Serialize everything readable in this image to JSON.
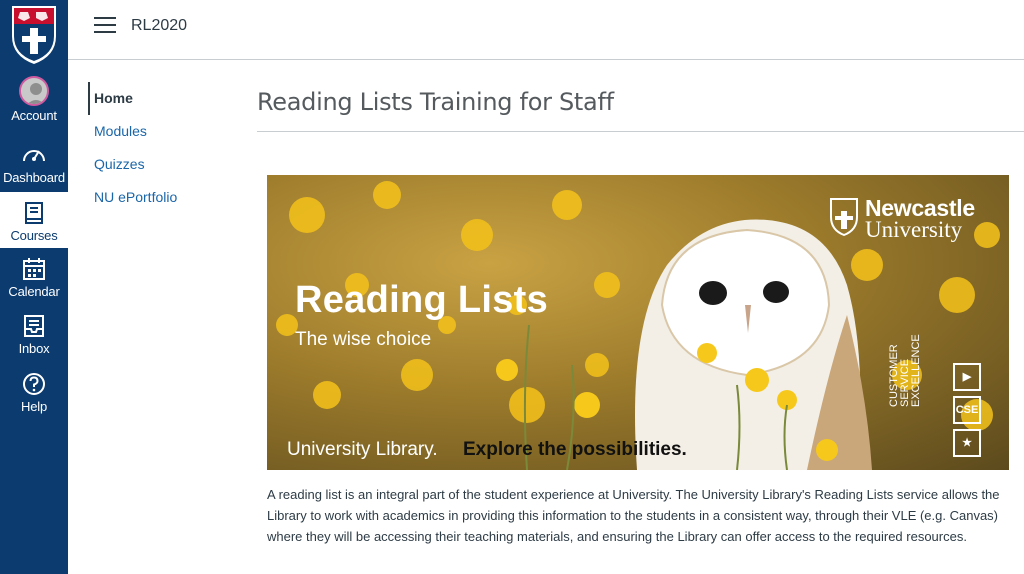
{
  "global_nav": {
    "items": [
      {
        "label": "Account",
        "icon": "avatar"
      },
      {
        "label": "Dashboard",
        "icon": "speedometer-icon"
      },
      {
        "label": "Courses",
        "icon": "book-icon"
      },
      {
        "label": "Calendar",
        "icon": "calendar-icon"
      },
      {
        "label": "Inbox",
        "icon": "inbox-icon"
      },
      {
        "label": "Help",
        "icon": "help-icon"
      }
    ],
    "active": "Courses",
    "brand_color": "#0b3b6f"
  },
  "header": {
    "breadcrumb": "RL2020"
  },
  "course_nav": {
    "items": [
      "Home",
      "Modules",
      "Quizzes",
      "NU ePortfolio"
    ],
    "active": "Home"
  },
  "page": {
    "title": "Reading Lists Training for Staff"
  },
  "banner": {
    "headline": "Reading Lists",
    "subline": "The wise choice",
    "footer_part1": "University Library.",
    "footer_part2": "Explore the possibilities.",
    "logo_line1": "Newcastle",
    "logo_line2": "University",
    "cse_text": [
      "CUSTOMER",
      "SERVICE",
      "EXCELLENCE"
    ],
    "cse_badges": [
      "▶",
      "CSE",
      "★"
    ]
  },
  "body_text": "A reading list is an integral part of the student experience at University. The University Library's Reading Lists service allows the Library to work with academics in providing this information to the students in a consistent way, through their VLE (e.g. Canvas) where they will be accessing their teaching materials, and ensuring the Library can offer access to the required resources."
}
